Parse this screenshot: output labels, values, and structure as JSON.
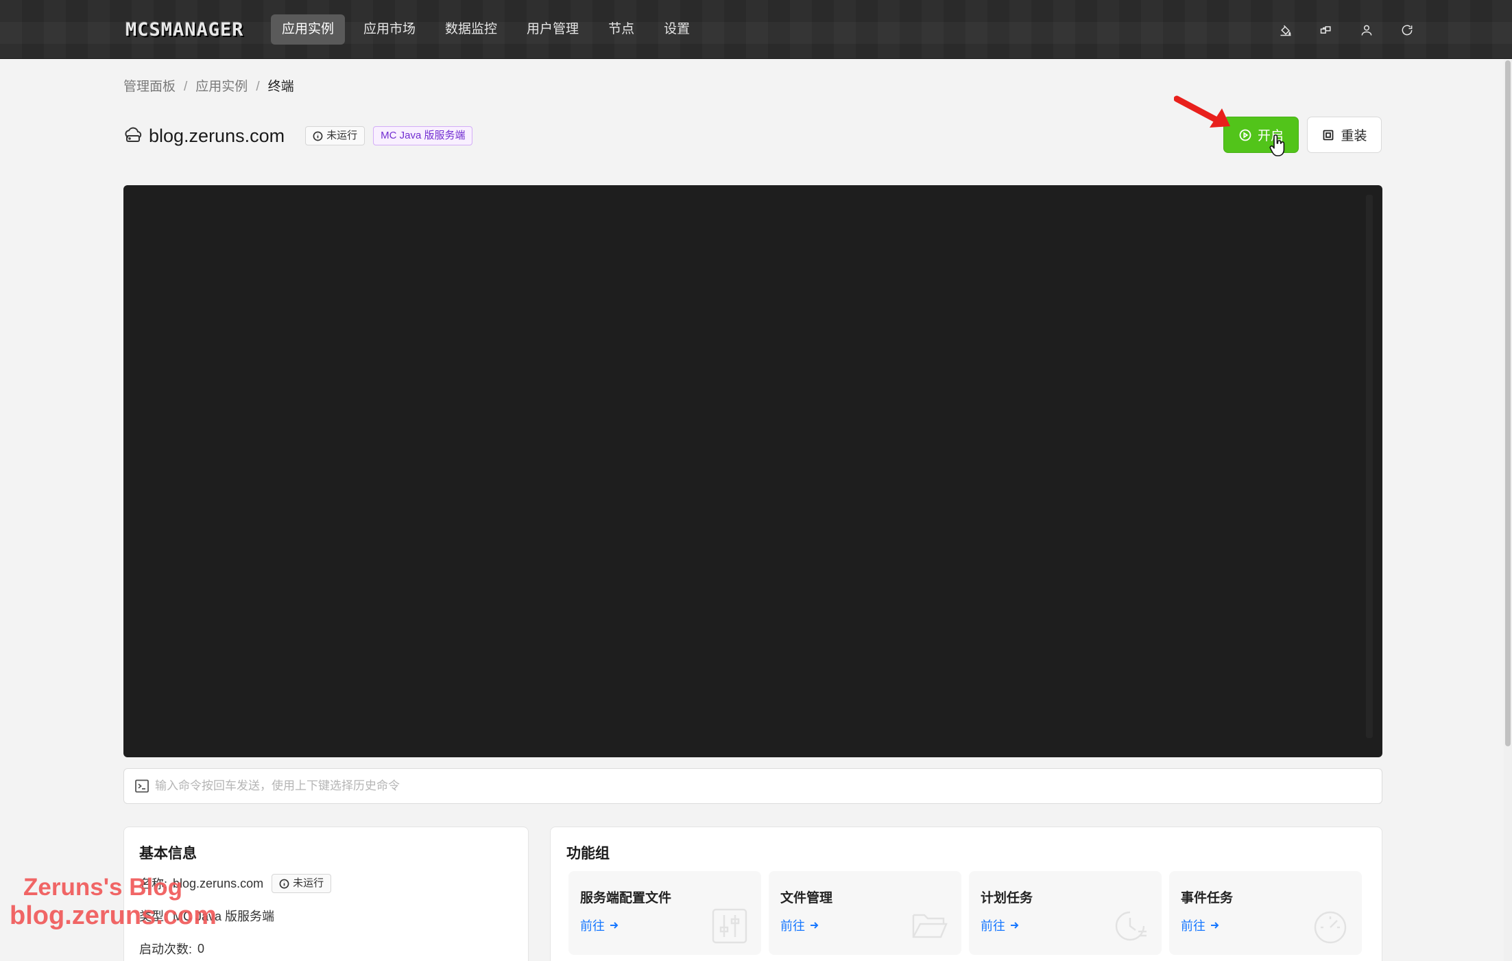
{
  "header": {
    "logo": "MCSMANAGER",
    "nav": [
      {
        "label": "应用实例",
        "active": true
      },
      {
        "label": "应用市场",
        "active": false
      },
      {
        "label": "数据监控",
        "active": false
      },
      {
        "label": "用户管理",
        "active": false
      },
      {
        "label": "节点",
        "active": false
      },
      {
        "label": "设置",
        "active": false
      }
    ],
    "icons": [
      "paint-bucket-icon",
      "layout-icon",
      "user-icon",
      "refresh-icon"
    ]
  },
  "breadcrumb": [
    "管理面板",
    "应用实例",
    "终端"
  ],
  "instance": {
    "name": "blog.zeruns.com",
    "status": "未运行",
    "type_tag": "MC Java 版服务端"
  },
  "actions": {
    "start": "开启",
    "reinstall": "重装"
  },
  "command": {
    "placeholder": "输入命令按回车发送，使用上下键选择历史命令",
    "value": ""
  },
  "basic_info": {
    "title": "基本信息",
    "name_label": "名称:",
    "name_value": "blog.zeruns.com",
    "status": "未运行",
    "type_label": "类型:",
    "type_value": "MC Java 版服务端",
    "starts_label": "启动次数:",
    "starts_value": "0"
  },
  "features": {
    "title": "功能组",
    "tiles": [
      {
        "title": "服务端配置文件",
        "link": "前往",
        "icon": "sliders-icon"
      },
      {
        "title": "文件管理",
        "link": "前往",
        "icon": "folder-open-icon"
      },
      {
        "title": "计划任务",
        "link": "前往",
        "icon": "clock-icon"
      },
      {
        "title": "事件任务",
        "link": "前往",
        "icon": "dashboard-icon"
      }
    ]
  },
  "watermark": {
    "line1": "Zeruns's Blog",
    "line2": "blog.zeruns.com"
  },
  "colors": {
    "header_bg": "#2c2c2c",
    "start_button": "#52c41a",
    "link": "#1677ff",
    "type_tag": "#722ed1",
    "terminal_bg": "#1e1e1e",
    "annotation_arrow": "#e8201c"
  }
}
